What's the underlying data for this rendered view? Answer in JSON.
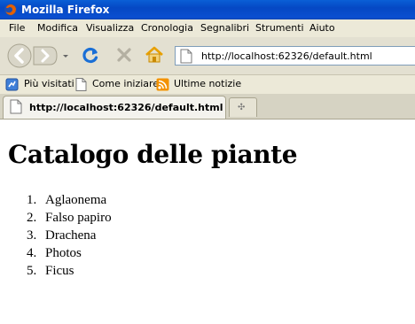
{
  "window": {
    "title": "Mozilla Firefox"
  },
  "menu": [
    {
      "label": "File"
    },
    {
      "label": "Modifica"
    },
    {
      "label": "Visualizza"
    },
    {
      "label": "Cronologia"
    },
    {
      "label": "Segnalibri"
    },
    {
      "label": "Strumenti"
    },
    {
      "label": "Aiuto"
    }
  ],
  "address": {
    "url": "http://localhost:62326/default.html"
  },
  "bookmarks": [
    {
      "label": "Più visitati",
      "icon": "most-visited-icon"
    },
    {
      "label": "Come iniziare",
      "icon": "page-icon"
    },
    {
      "label": "Ultime notizie",
      "icon": "rss-feed-icon"
    }
  ],
  "tab": {
    "label": "http://localhost:62326/default.html"
  },
  "page": {
    "heading": "Catalogo delle piante",
    "items": [
      {
        "num": "1.",
        "text": "Aglaonema"
      },
      {
        "num": "2.",
        "text": "Falso papiro"
      },
      {
        "num": "3.",
        "text": "Drachena"
      },
      {
        "num": "4.",
        "text": "Photos"
      },
      {
        "num": "5.",
        "text": "Ficus"
      }
    ]
  },
  "colors": {
    "titlebar": "#0a4fd0",
    "chrome": "#ece9d8",
    "reload": "#1a6fd6",
    "home": "#e8a000"
  }
}
